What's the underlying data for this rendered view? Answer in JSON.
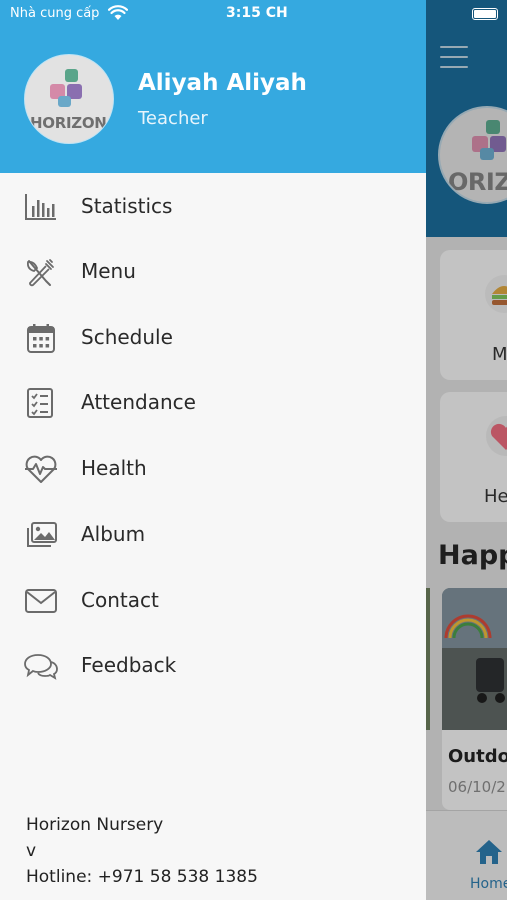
{
  "status_bar": {
    "carrier": "Nhà cung cấp",
    "time": "3:15 CH"
  },
  "drawer": {
    "user": {
      "name": "Aliyah Aliyah",
      "role": "Teacher",
      "logo_text": "HORIZON"
    },
    "menu": [
      {
        "label": "Statistics",
        "icon": "bar-chart-icon"
      },
      {
        "label": "Menu",
        "icon": "utensils-icon"
      },
      {
        "label": "Schedule",
        "icon": "calendar-icon"
      },
      {
        "label": "Attendance",
        "icon": "checklist-icon"
      },
      {
        "label": "Health",
        "icon": "heart-pulse-icon"
      },
      {
        "label": "Album",
        "icon": "album-icon"
      },
      {
        "label": "Contact",
        "icon": "envelope-icon"
      },
      {
        "label": "Feedback",
        "icon": "chat-icon"
      }
    ],
    "footer": {
      "line1": "Horizon Nursery",
      "line2": "v",
      "line3": "Hotline: +971 58 538 1385"
    }
  },
  "background": {
    "logo_text": "ORIZO",
    "card1_label": "M",
    "card2_label": "He",
    "section_title": "Happ",
    "photo_title": "Outdo",
    "photo_date": "06/10/2",
    "tab_home": "Home"
  },
  "colors": {
    "header_blue": "#35a9e0",
    "drawer_bg": "#f7f7f7",
    "icon_gray": "#6b6b6b"
  }
}
